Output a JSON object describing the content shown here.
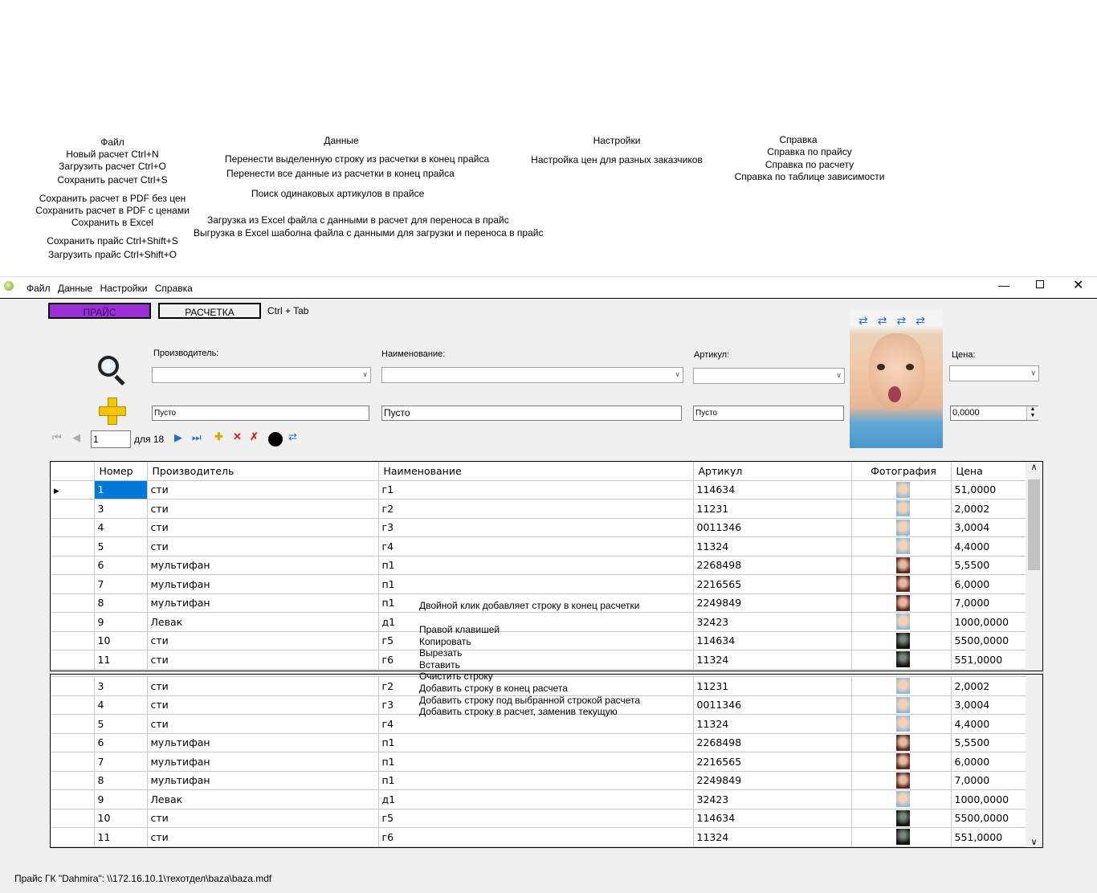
{
  "annotations": {
    "file": {
      "title": "Файл",
      "items": [
        "Новый расчет Ctrl+N",
        "Загрузить расчет Ctrl+O",
        "Сохранить расчет Ctrl+S",
        "Сохранить расчет в PDF без цен",
        "Сохранить расчет в PDF с ценами",
        "Сохранить в Excel",
        "Сохранить прайс Ctrl+Shift+S",
        "Загрузить прайс Ctrl+Shift+O"
      ]
    },
    "data": {
      "title": "Данные",
      "items": [
        "Перенести выделенную строку из расчетки в конец прайса",
        "Перенести все данные из расчетки в конец прайса",
        "Поиск одинаковых артикулов в прайсе",
        "Загрузка из Excel файла с данными в расчет для переноса в прайс",
        "Выгрузка в Excel шаболна файла с данными для загрузки и переноса в прайс"
      ]
    },
    "settings": {
      "title": "Настройки",
      "items": [
        "Настройка цен для разных заказчиков"
      ]
    },
    "help": {
      "title": "Справка",
      "items": [
        "Справка по прайсу",
        "Справка по расчету",
        "Справка по таблице зависимости"
      ]
    },
    "hint_dblclick": "Двойной клик добавляет строку в конец расчетки",
    "context_menu": [
      "Правой клавишей",
      "Копировать",
      "Вырезать",
      "Вставить",
      "Очистить строку",
      "Добавить строку в конец расчета",
      "Добавить строку под выбранной строкой расчета",
      "Добавить строку в расчет, заменив текущую"
    ]
  },
  "menu": [
    "Файл",
    "Данные",
    "Настройки",
    "Справка"
  ],
  "tabs": {
    "price": "ПРАЙС",
    "calc": "РАСЧЕТКА",
    "hotkey": "Ctrl + Tab"
  },
  "filters": {
    "maker_label": "Производитель:",
    "name_label": "Наименование:",
    "article_label": "Артикул:",
    "price_label": "Цена:"
  },
  "new_row": {
    "maker": "Пусто",
    "name": "Пусто",
    "article": "Пусто",
    "price": "0,0000"
  },
  "navigator": {
    "position": "1",
    "of_label": "для 18"
  },
  "columns": [
    "Номер",
    "Производитель",
    "Наименование",
    "Артикул",
    "Фотография",
    "Цена"
  ],
  "rows_top": [
    {
      "n": "1",
      "maker": "сти",
      "name": "г1",
      "article": "114634",
      "price": "51,0000",
      "photo": "child"
    },
    {
      "n": "3",
      "maker": "сти",
      "name": "г2",
      "article": "11231",
      "price": "2,0002",
      "photo": "child"
    },
    {
      "n": "4",
      "maker": "сти",
      "name": "г3",
      "article": "0011346",
      "price": "3,0004",
      "photo": "child"
    },
    {
      "n": "5",
      "maker": "сти",
      "name": "г4",
      "article": "11324",
      "price": "4,4000",
      "photo": "child"
    },
    {
      "n": "6",
      "maker": "мультифан",
      "name": "п1",
      "article": "2268498",
      "price": "5,5500",
      "photo": "woman"
    },
    {
      "n": "7",
      "maker": "мультифан",
      "name": "п1",
      "article": "2216565",
      "price": "6,0000",
      "photo": "woman"
    },
    {
      "n": "8",
      "maker": "мультифан",
      "name": "п1",
      "article": "2249849",
      "price": "7,0000",
      "photo": "woman"
    },
    {
      "n": "9",
      "maker": "Левак",
      "name": "д1",
      "article": "32423",
      "price": "1000,0000",
      "photo": "child"
    },
    {
      "n": "10",
      "maker": "сти",
      "name": "г5",
      "article": "114634",
      "price": "5500,0000",
      "photo": "dark"
    },
    {
      "n": "11",
      "maker": "сти",
      "name": "г6",
      "article": "11324",
      "price": "551,0000",
      "photo": "dark"
    }
  ],
  "rows_bottom": [
    {
      "n": "3",
      "maker": "сти",
      "name": "г2",
      "article": "11231",
      "price": "2,0002",
      "photo": "child"
    },
    {
      "n": "4",
      "maker": "сти",
      "name": "г3",
      "article": "0011346",
      "price": "3,0004",
      "photo": "child"
    },
    {
      "n": "5",
      "maker": "сти",
      "name": "г4",
      "article": "11324",
      "price": "4,4000",
      "photo": "child"
    },
    {
      "n": "6",
      "maker": "мультифан",
      "name": "п1",
      "article": "2268498",
      "price": "5,5500",
      "photo": "woman"
    },
    {
      "n": "7",
      "maker": "мультифан",
      "name": "п1",
      "article": "2216565",
      "price": "6,0000",
      "photo": "woman"
    },
    {
      "n": "8",
      "maker": "мультифан",
      "name": "п1",
      "article": "2249849",
      "price": "7,0000",
      "photo": "woman"
    },
    {
      "n": "9",
      "maker": "Левак",
      "name": "д1",
      "article": "32423",
      "price": "1000,0000",
      "photo": "child"
    },
    {
      "n": "10",
      "maker": "сти",
      "name": "г5",
      "article": "114634",
      "price": "5500,0000",
      "photo": "dark"
    },
    {
      "n": "11",
      "maker": "сти",
      "name": "г6",
      "article": "11324",
      "price": "551,0000",
      "photo": "dark"
    }
  ],
  "status": "Прайс ГК \"Dahmira\": \\\\172.16.10.1\\техотдел\\baza\\baza.mdf",
  "colors": {
    "price_tab": "#9b30d9",
    "selection": "#0078d7"
  }
}
